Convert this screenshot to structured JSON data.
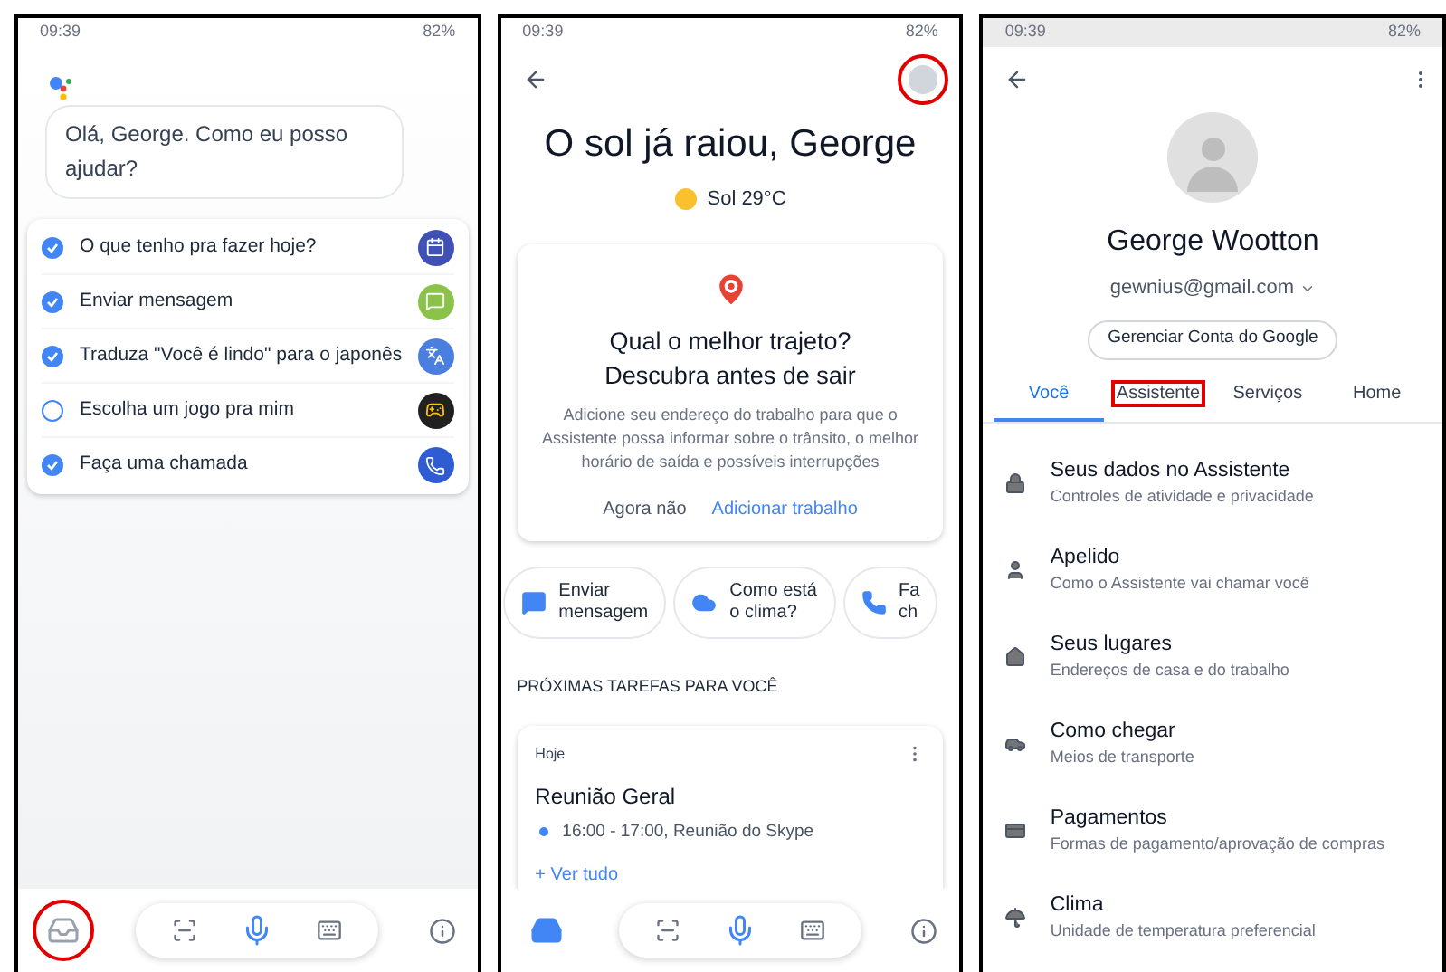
{
  "assistant_screen": {
    "status_bar": {
      "time": "09:39",
      "battery": "82%"
    },
    "greeting": "Olá, George. Como eu posso ajudar?",
    "suggestions": [
      {
        "label": "O que tenho pra fazer hoje?",
        "checked": true,
        "color": "#3f51b5"
      },
      {
        "label": "Enviar mensagem",
        "checked": true,
        "color": "#8bc34a"
      },
      {
        "label": "Traduza \"Você é lindo\" para o japonês",
        "checked": true,
        "color": "#4a7fe0"
      },
      {
        "label": "Escolha um jogo pra mim",
        "checked": false,
        "color": "#212121"
      },
      {
        "label": "Faça uma chamada",
        "checked": true,
        "color": "#2f5bd3"
      }
    ],
    "bottom_bar": {
      "explore_selected": false,
      "explore_annotated": true
    }
  },
  "updates_screen": {
    "status_bar": {
      "time": "09:39",
      "battery": "82%"
    },
    "avatar_annotated": true,
    "title": "O sol já raiou, George",
    "weather": "Sol 29°C",
    "card": {
      "heading": [
        "Qual o melhor trajeto?",
        "Descubra antes de sair"
      ],
      "body": "Adicione seu endereço do trabalho para que o Assistente possa informar sobre o trânsito, o melhor horário de saída e possíveis interrupções",
      "buttons": [
        {
          "label": "Agora não",
          "kind": "plain"
        },
        {
          "label": "Adicionar trabalho",
          "kind": "primary"
        }
      ]
    },
    "chips": [
      {
        "lines": [
          "Enviar",
          "mensagem"
        ],
        "kind": "message"
      },
      {
        "lines": [
          "Como está",
          "o clima?"
        ],
        "kind": "cloud"
      },
      {
        "lines": [
          "Fa",
          "ch"
        ],
        "kind": "phone"
      }
    ],
    "section_heading": "PRÓXIMAS TAREFAS PARA VOCÊ",
    "task_card": {
      "day": "Hoje",
      "title": "Reunião Geral",
      "event": "16:00 - 17:00, Reunião do Skype",
      "link": "+ Ver tudo"
    },
    "bottom_bar": {
      "explore_selected": true,
      "explore_annotated": false
    }
  },
  "settings_screen": {
    "status_bar": {
      "time": "09:39",
      "battery": "82%"
    },
    "name": "George Wootton",
    "email": "gewnius@gmail.com",
    "manage_button": "Gerenciar Conta do Google",
    "tabs": [
      {
        "label": "Você",
        "selected": true,
        "annotated": false
      },
      {
        "label": "Assistente",
        "selected": false,
        "annotated": true
      },
      {
        "label": "Serviços",
        "selected": false,
        "annotated": false
      },
      {
        "label": "Home",
        "selected": false,
        "annotated": false
      }
    ],
    "items": [
      {
        "kind": "lock",
        "title": "Seus dados no Assistente",
        "subtitle": "Controles de atividade e privacidade"
      },
      {
        "kind": "person",
        "title": "Apelido",
        "subtitle": "Como o Assistente vai chamar você"
      },
      {
        "kind": "home",
        "title": "Seus lugares",
        "subtitle": "Endereços de casa e do trabalho"
      },
      {
        "kind": "car",
        "title": "Como chegar",
        "subtitle": "Meios de transporte"
      },
      {
        "kind": "card",
        "title": "Pagamentos",
        "subtitle": "Formas de pagamento/aprovação de compras"
      },
      {
        "kind": "umbrella",
        "title": "Clima",
        "subtitle": "Unidade de temperatura preferencial"
      }
    ]
  }
}
